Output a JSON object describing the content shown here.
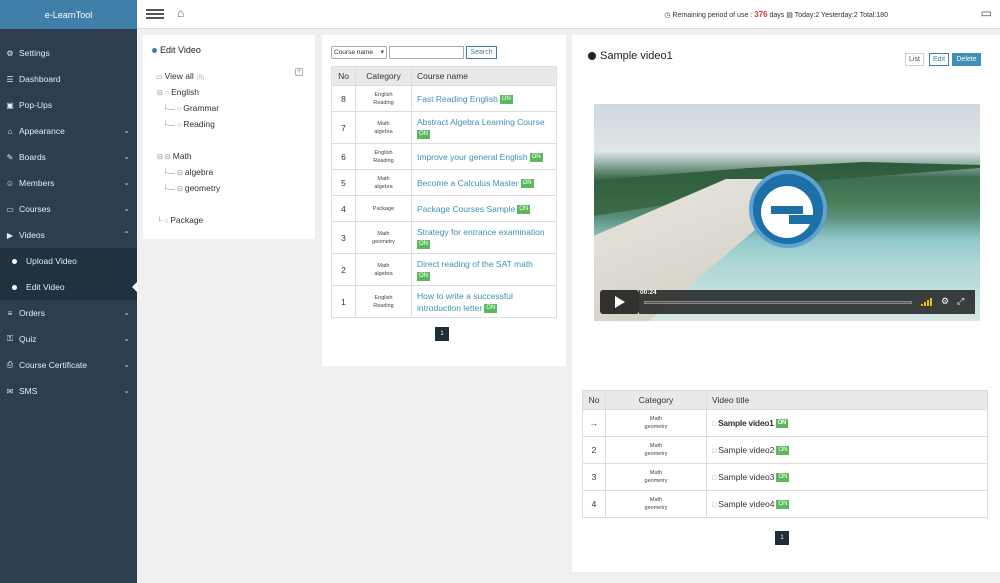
{
  "brand": "e-LearnTool",
  "sidebar": {
    "items": [
      {
        "label": "Settings",
        "icon": "gears-icon",
        "glyph": "⚙"
      },
      {
        "label": "Dashboard",
        "icon": "sitemap-icon",
        "glyph": "☰"
      },
      {
        "label": "Pop-Ups",
        "icon": "image-icon",
        "glyph": "▣"
      },
      {
        "label": "Appearance",
        "icon": "home-icon",
        "glyph": "⌂"
      },
      {
        "label": "Boards",
        "icon": "pencil-icon",
        "glyph": "✎"
      },
      {
        "label": "Members",
        "icon": "users-icon",
        "glyph": "☺"
      },
      {
        "label": "Courses",
        "icon": "folder-icon",
        "glyph": "▭"
      },
      {
        "label": "Videos",
        "icon": "video-icon",
        "glyph": "▶"
      }
    ],
    "video_subitems": [
      {
        "label": "Upload Video"
      },
      {
        "label": "Edit Video"
      }
    ],
    "items_after": [
      {
        "label": "Orders",
        "icon": "list-icon",
        "glyph": "≡"
      },
      {
        "label": "Quiz",
        "icon": "key-icon",
        "glyph": "⚿"
      },
      {
        "label": "Course Certificate",
        "icon": "print-icon",
        "glyph": "⎙"
      },
      {
        "label": "SMS",
        "icon": "envelope-icon",
        "glyph": "✉"
      }
    ]
  },
  "topbar": {
    "status_prefix": "Remaining period of use :",
    "remaining_days": "376",
    "days_suffix": "days",
    "stats": "Today:2  Yesterday:2  Total:180"
  },
  "tree": {
    "title": "Edit Video",
    "view_all": "View all",
    "view_all_count": "(8)",
    "nodes": [
      {
        "label": "English"
      },
      {
        "label": "Grammar"
      },
      {
        "label": "Reading"
      },
      {
        "label": "Math"
      },
      {
        "label": "algebra"
      },
      {
        "label": "geometry"
      },
      {
        "label": "Package"
      }
    ]
  },
  "course_search": {
    "select_value": "Course name",
    "button_label": "Search"
  },
  "course_table": {
    "headers": [
      "No",
      "Category",
      "Course name"
    ],
    "rows": [
      {
        "no": "8",
        "cat1": "English",
        "cat2": "Reading",
        "name": "Fast Reading English",
        "status": "ON"
      },
      {
        "no": "7",
        "cat1": "Math",
        "cat2": "algebra",
        "name": "Abstract Algebra Learning Course",
        "status": "ON"
      },
      {
        "no": "6",
        "cat1": "English",
        "cat2": "Reading",
        "name": "Improve your general English",
        "status": "ON"
      },
      {
        "no": "5",
        "cat1": "Math",
        "cat2": "algebra",
        "name": "Become a Calculus Master",
        "status": "ON"
      },
      {
        "no": "4",
        "cat1": "Package",
        "cat2": "",
        "name": "Package Courses Sample",
        "status": "ON"
      },
      {
        "no": "3",
        "cat1": "Math",
        "cat2": "geometry",
        "name": "Strategy for entrance examination",
        "status": "ON"
      },
      {
        "no": "2",
        "cat1": "Math",
        "cat2": "algebra",
        "name": "Direct reading of the SAT math",
        "status": "ON"
      },
      {
        "no": "1",
        "cat1": "English",
        "cat2": "Reading",
        "name": "How to write a successful introduction letter",
        "status": "ON"
      }
    ],
    "page": "1"
  },
  "video": {
    "title": "Sample video1",
    "btn_list": "List",
    "btn_edit": "Edit",
    "btn_delete": "Delete",
    "player_time": "00:24"
  },
  "video_table": {
    "headers": [
      "No",
      "Category",
      "Video title"
    ],
    "rows": [
      {
        "no": "→",
        "cat1": "Math",
        "cat2": "geometry",
        "title": "Sample video1",
        "status": "ON"
      },
      {
        "no": "2",
        "cat1": "Math",
        "cat2": "geometry",
        "title": "Sample video2",
        "status": "ON"
      },
      {
        "no": "3",
        "cat1": "Math",
        "cat2": "geometry",
        "title": "Sample video3",
        "status": "ON"
      },
      {
        "no": "4",
        "cat1": "Math",
        "cat2": "geometry",
        "title": "Sample video4",
        "status": "ON"
      }
    ],
    "page": "1"
  },
  "colors": {
    "sidebar": "#2c3e50",
    "brand": "#3f7fa8",
    "accent": "#3f8fb6",
    "on_badge": "#5cb85c",
    "remaining": "#e03a3a"
  }
}
